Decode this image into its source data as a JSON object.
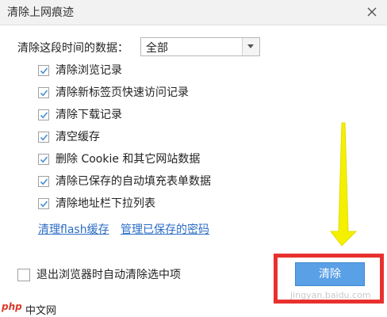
{
  "window": {
    "title": "清除上网痕迹"
  },
  "range": {
    "label": "清除这段时间的数据：",
    "selected": "全部"
  },
  "options": [
    {
      "label": "清除浏览记录",
      "checked": true
    },
    {
      "label": "清除新标签页快速访问记录",
      "checked": true
    },
    {
      "label": "清除下载记录",
      "checked": true
    },
    {
      "label": "清空缓存",
      "checked": true
    },
    {
      "label": "删除 Cookie 和其它网站数据",
      "checked": true
    },
    {
      "label": "清除已保存的自动填充表单数据",
      "checked": true
    },
    {
      "label": "清除地址栏下拉列表",
      "checked": true
    }
  ],
  "links": {
    "flash_cache": "清理flash缓存",
    "saved_passwords": "管理已保存的密码"
  },
  "auto_clear": {
    "label": "退出浏览器时自动清除选中项",
    "checked": false
  },
  "clear_button": {
    "label": "清除"
  },
  "colors": {
    "accent": "#5aa0e6",
    "link": "#2b6cc4",
    "highlight_box": "#e8312f",
    "arrow": "#f5f000"
  },
  "watermarks": {
    "left_logo": "php",
    "left_text": "中文网",
    "right_text": "jingyan.baidu.com"
  },
  "icons": {
    "close": "close-icon",
    "dropdown": "chevron-down-icon",
    "check": "check-icon",
    "annotation": "arrow-down-icon"
  }
}
